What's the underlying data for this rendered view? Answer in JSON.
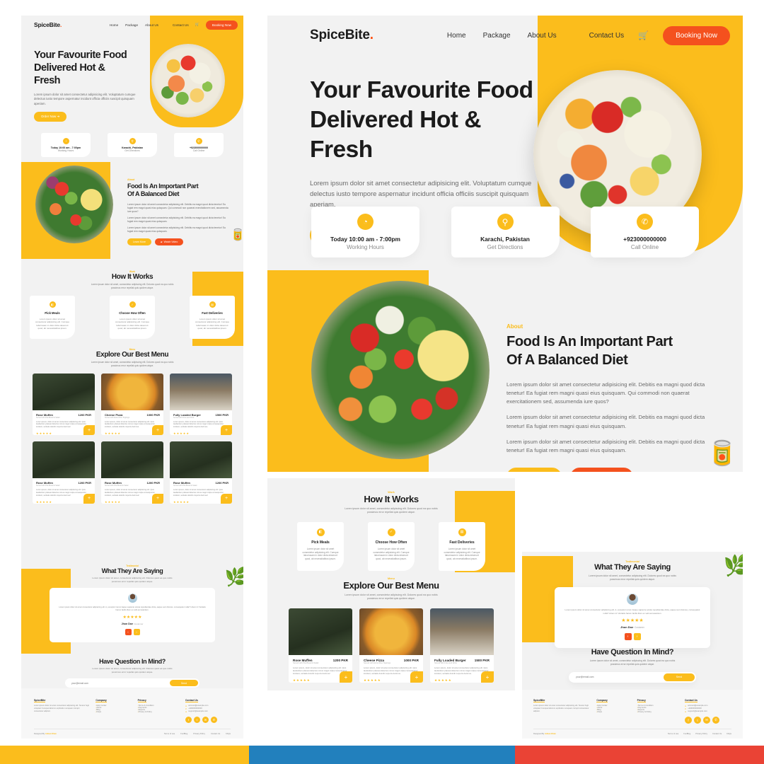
{
  "brand": {
    "name": "SpiceBite",
    "dot": ".",
    "accent_yellow": "#fbbd1c",
    "accent_orange": "#f4511e",
    "text_dark": "#1b1b1b",
    "surface": "#f2f2f2"
  },
  "nav": {
    "links": [
      "Home",
      "Package",
      "About Us"
    ],
    "contact": "Contact Us",
    "cart_icon": "cart-icon",
    "booking_label": "Booking Now"
  },
  "hero": {
    "title_lines": [
      "Your Favourite Food",
      "Delivered Hot &",
      "Fresh"
    ],
    "paragraph": "Lorem ipsum dolor sit amet consectetur adipisicing elit. Voluptatum cumque delectus iusto tempore aspernatur incidunt officia officiis suscipit quisquam aperiam.",
    "cta_label": "Order Now ➜"
  },
  "info_cards": [
    {
      "icon": "clock-icon",
      "title": "Today 10:00 am - 7:00pm",
      "subtitle": "Working Hours"
    },
    {
      "icon": "location-pin-icon",
      "title": "Karachi, Pakistan",
      "subtitle": "Get Directions"
    },
    {
      "icon": "phone-icon",
      "title": "+923000000000",
      "subtitle": "Call Online"
    }
  ],
  "about": {
    "kicker": "About",
    "title_lines": [
      "Food Is An Important Part",
      "Of A Balanced Diet"
    ],
    "paragraphs": [
      "Lorem ipsum dolor sit amet consectetur adipisicing elit. Debitis ea magni quod dicta tenetur! Ea fugiat rem magni quasi eius quisquam. Qui commodi non quaerat exercitationem sed, assumenda iure quos?",
      "Lorem ipsum dolor sit amet consectetur adipisicing elit. Debitis ea magni quod dicta tenetur! Ea fugiat rem magni quasi eius quisquam.",
      "Lorem ipsum dolor sit amet consectetur adipisicing elit. Debitis ea magni quod dicta tenetur! Ea fugiat rem magni quasi eius quisquam."
    ],
    "btn_learn": "Learn More",
    "btn_watch": "Watch Video",
    "watch_icon": "video-camera-icon"
  },
  "how_it_works": {
    "kicker": "Work",
    "title": "How It Works",
    "paragraph": "Lorem ipsum dolor sit amet, consectetur adipiscing elit. Dolores quod ea quo nobis possimus error repellat quis quidem atque.",
    "steps": [
      {
        "icon": "burger-meal-icon",
        "title": "Pick Meals",
        "text": "Lorem ipsum dolor sit amet consectetur adipisicing elit. Cumque laboriosam in dolor dicta deserunt quod, ab necessitatibus ipsum."
      },
      {
        "icon": "calendar-check-icon",
        "title": "Choose How Often",
        "text": "Lorem ipsum dolor sit amet consectetur adipisicing elit. Cumque laboriosam in dolor dicta deserunt quod, ab necessitatibus ipsum."
      },
      {
        "icon": "delivery-truck-icon",
        "title": "Fast Deliveries",
        "text": "Lorem ipsum dolor sit amet consectetur adipisicing elit. Cumque laboriosam in dolor dicta deserunt quod, ab necessitatibus ipsum."
      }
    ]
  },
  "menu": {
    "kicker": "Menu",
    "title": "Explore Our Best Menu",
    "paragraph": "Lorem ipsum dolor sit amet, consectetur adipiscing elit. Dolores quod ea quo nobis possimus error repellat quis quidem atque.",
    "stars": "★★★★★",
    "add_icon": "plus-icon",
    "items": [
      {
        "name": "Rose Muffen",
        "price": "1200 PKR",
        "sub": "Served with Pita Bread & Salad",
        "desc": "Lorem ipsum, dolor sit amet consectetur adipisicing elit. Quis laudantium placeat delectus minus magni culpa consequuntur incidunt, veritatis dolorib corporis ducimus!"
      },
      {
        "name": "Cheese Pizza",
        "price": "1000 PKR",
        "sub": "Served with Extra Olive Toppings",
        "desc": "Lorem ipsum, dolor sit amet consectetur adipisicing elit. Quis laudantium placeat delectus minus magni culpa consequuntur incidunt, veritatis dolorib corporis ducimus."
      },
      {
        "name": "Fully Loaded Burger",
        "price": "1500 PKR",
        "sub": "Served with Fries and Drink",
        "desc": "Lorem ipsum, dolor sit amet consectetur adipisicing elit. Quis laudantium placeat delectus minus magni culpa consequuntur incidunt, veritatis dolorib corporis ducimus."
      },
      {
        "name": "Rose Muffen",
        "price": "1200 PKR",
        "sub": "Served with Pita Bread & Salad",
        "desc": "Lorem ipsum, dolor sit amet consectetur adipisicing elit. Quis laudantium placeat delectus minus magni culpa consequuntur incidunt, veritatis dolorib corporis ducimus!"
      },
      {
        "name": "Rose Muffen",
        "price": "1200 PKR",
        "sub": "Served with Pita Bread & Salad",
        "desc": "Lorem ipsum, dolor sit amet consectetur adipisicing elit. Quis laudantium placeat delectus minus magni culpa consequuntur incidunt, veritatis dolorib corporis ducimus!"
      },
      {
        "name": "Rose Muffen",
        "price": "1200 PKR",
        "sub": "Served with Pita Bread & Salad",
        "desc": "Lorem ipsum, dolor sit amet consectetur adipisicing elit. Quis laudantium placeat delectus minus magni culpa consequuntur incidunt, veritatis dolorib corporis ducimus!"
      }
    ]
  },
  "testimonial": {
    "kicker": "Testimonial",
    "title": "What They Are Saying",
    "paragraph": "Lorem ipsum dolor sit amet, consectetur adipiscing elit. Dolores quod ea quo nobis possimus error repellat quis quidem atque.",
    "quote": "Lorem ipsum dolor sit amet consectetur adipisicing elit. A, excepturi rerum itaque sapiente soluta repudiandae dicta, eaque sunt dolores, consequatur nulla? Libero in! Veritatis harum facilis illum ex velit accusantium.",
    "stars": "★★★★★",
    "name": "Jhon Doe",
    "role": "Customer",
    "prev_icon": "chevron-left-icon",
    "next_icon": "chevron-right-icon",
    "avatar": "user-avatar"
  },
  "newsletter": {
    "title": "Have Question In Mind?",
    "paragraph": "Lorem ipsum dolor sit amet, consectetur adipiscing elit. Dolores quod ea quo nobis possimus error repellat quis quidem atque.",
    "placeholder": "your@email.com",
    "button": "Send"
  },
  "footer": {
    "brand_heading": "SpiceBite",
    "brand_text": "Lorem ipsum dolor sit amet consectetur adipisicing elit. Tenetur fugit voluptas! Cumque laborum explicabo numquam corrupti consectetur adipisci.",
    "columns": [
      {
        "heading": "Company",
        "items": [
          "Help Center",
          "About",
          "Blog",
          "FAQs"
        ]
      },
      {
        "heading": "Privacy",
        "items": [
          "Terms & Condition",
          "Payments",
          "Reports",
          "Privacy & Policy"
        ]
      }
    ],
    "contact_heading": "Contact Us",
    "contacts": [
      {
        "icon": "mail-icon",
        "text": "account@example.com"
      },
      {
        "icon": "phone-icon",
        "text": "+923000000000"
      },
      {
        "icon": "globe-icon",
        "text": "support@example.com"
      }
    ],
    "socials": [
      "facebook-icon",
      "twitter-icon",
      "mail-icon",
      "whatsapp-icon"
    ],
    "copyright_prefix": "Designed By ",
    "copyright_author": "Adnan Khan",
    "bottom_links": [
      "Terms of use",
      "FunBlog",
      "Privacy Policy",
      "Contact Us",
      "FAQs"
    ]
  },
  "colorbars": {
    "yellow": "#fbbd1c",
    "blue": "#2280bd",
    "red": "#ea4335"
  }
}
